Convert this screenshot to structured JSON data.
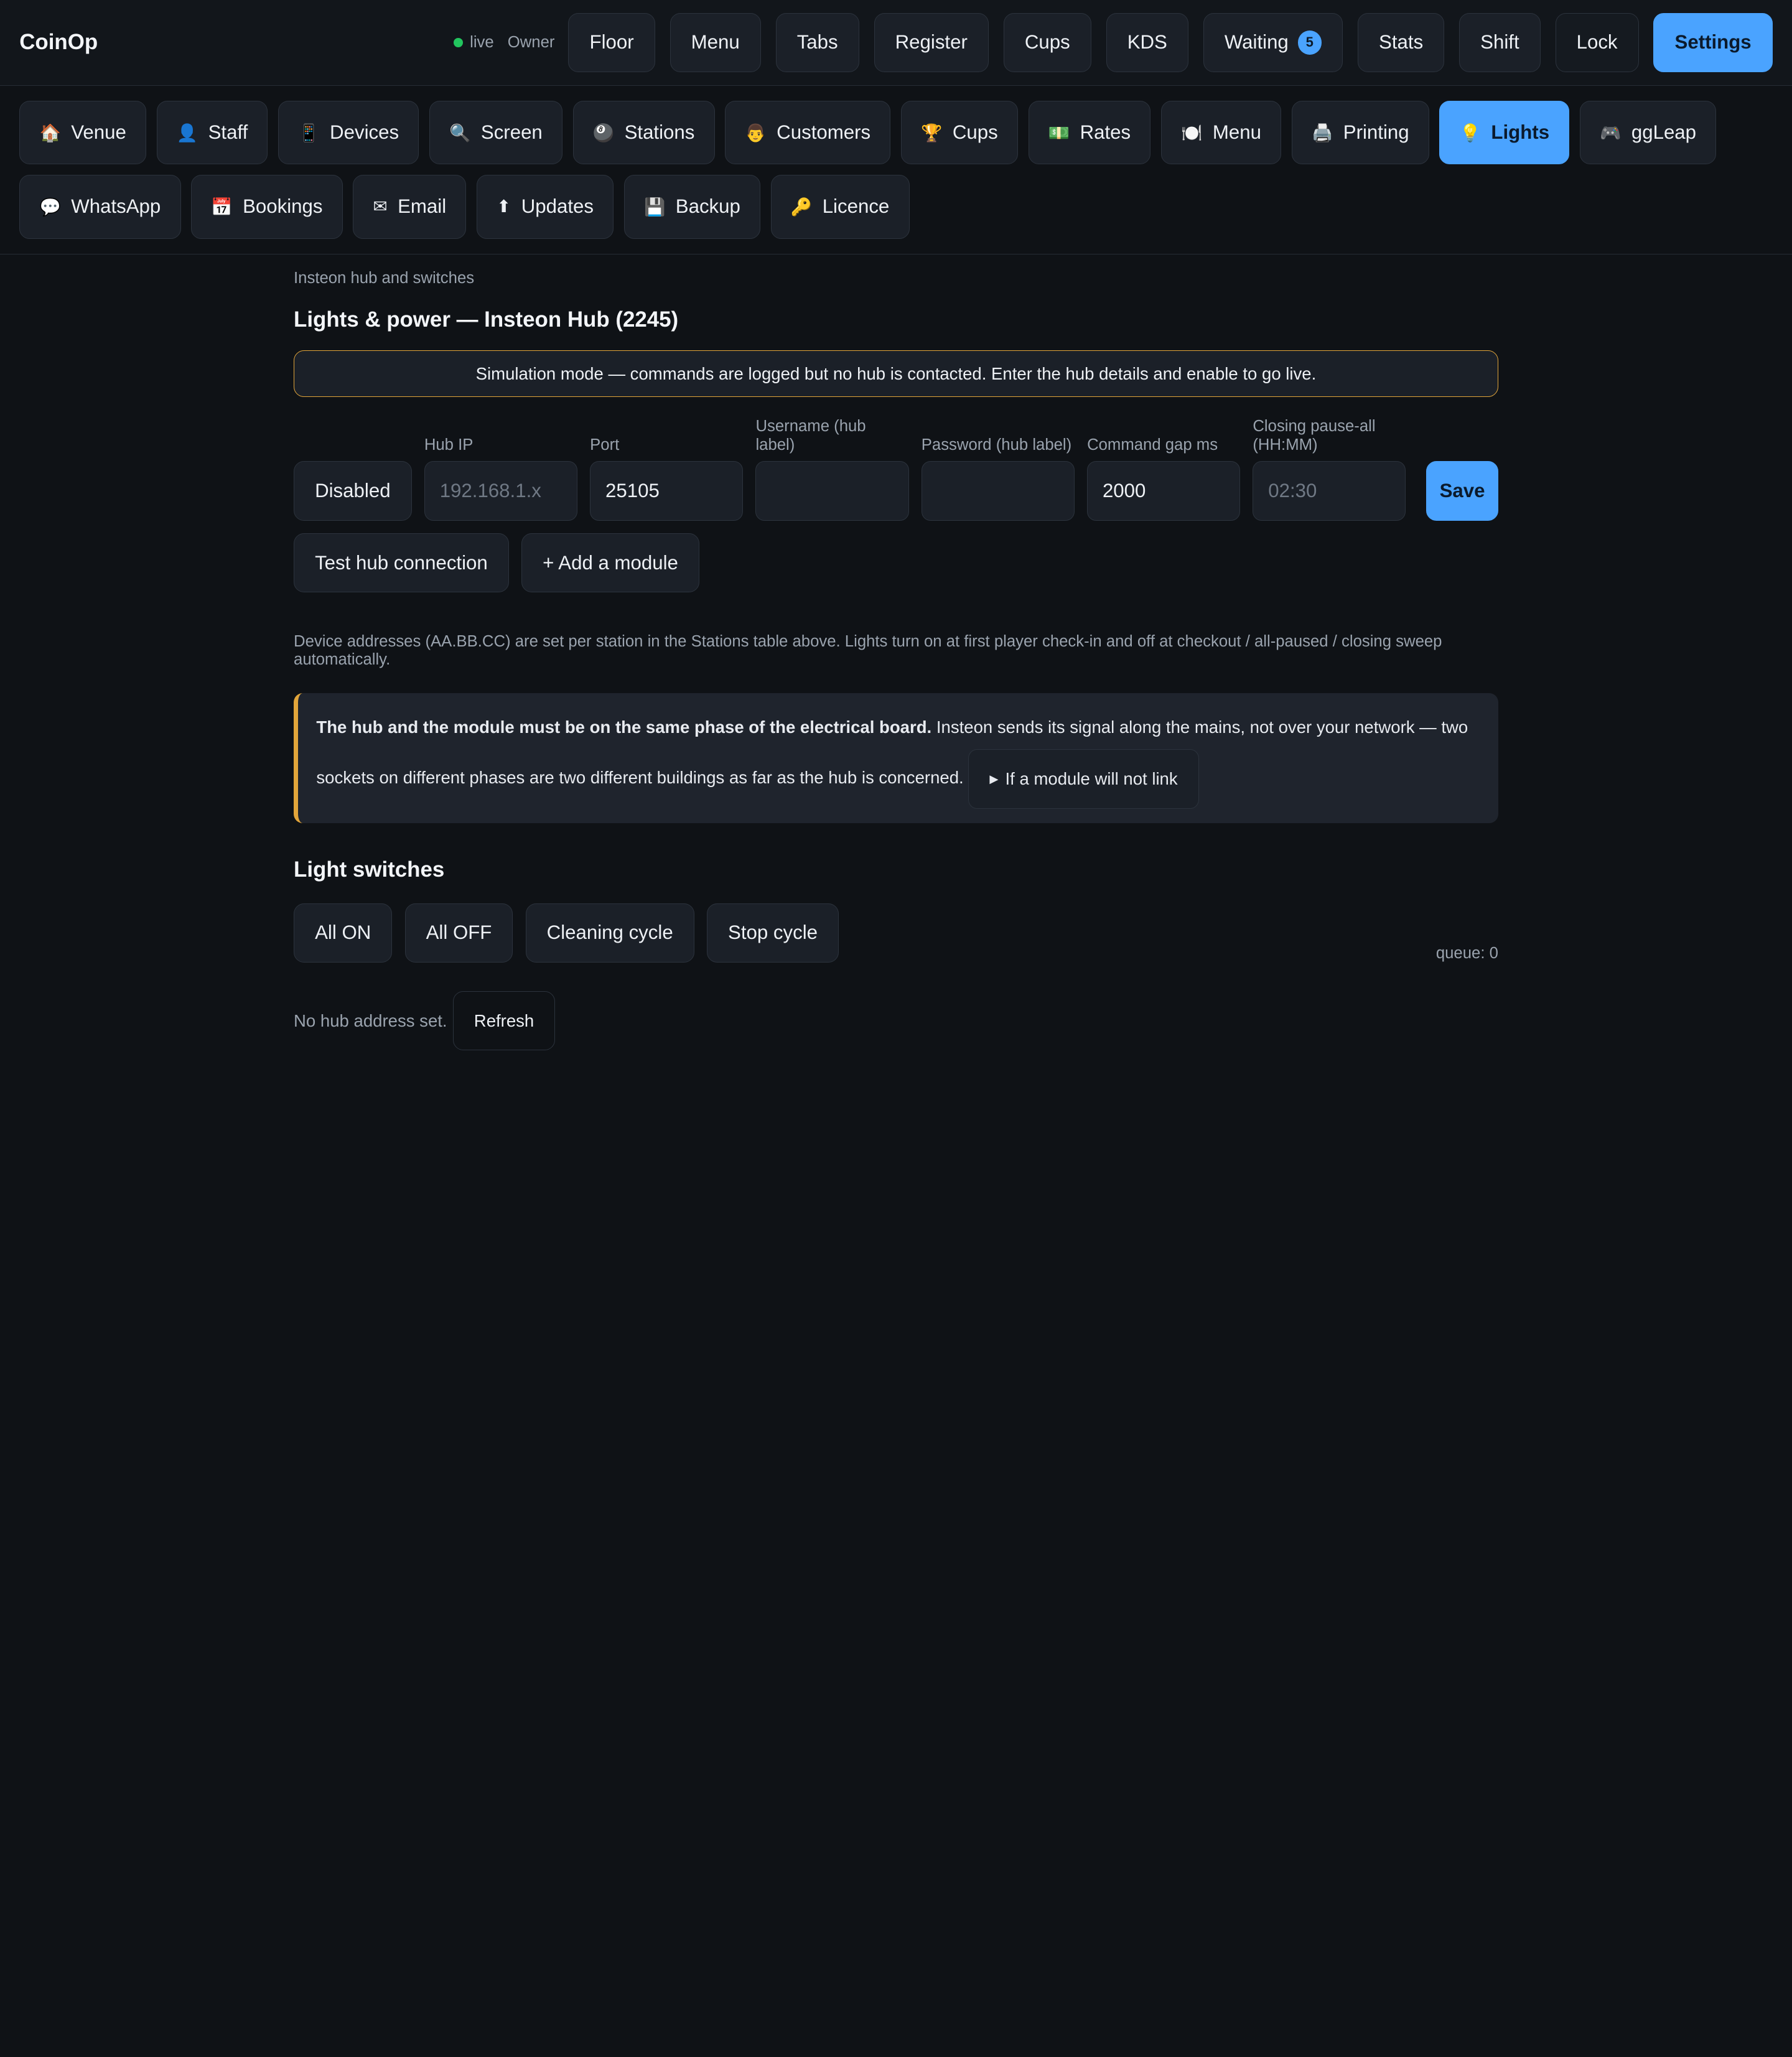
{
  "app": {
    "title": "CoinOp",
    "status": "live",
    "role": "Owner"
  },
  "colors": {
    "accent": "#4aa3ff",
    "warning": "#e2a53a",
    "live": "#22c55e"
  },
  "topnav": [
    {
      "label": "Floor"
    },
    {
      "label": "Menu"
    },
    {
      "label": "Tabs"
    },
    {
      "label": "Register"
    },
    {
      "label": "Cups"
    },
    {
      "label": "KDS"
    },
    {
      "label": "Waiting",
      "badge": "5"
    },
    {
      "label": "Stats"
    },
    {
      "label": "Shift"
    },
    {
      "label": "Lock"
    },
    {
      "label": "Settings",
      "active": true
    }
  ],
  "settings_tabs": [
    {
      "icon": "🏠",
      "icon_name": "house-icon",
      "label": "Venue"
    },
    {
      "icon": "👤",
      "icon_name": "person-icon",
      "label": "Staff"
    },
    {
      "icon": "📱",
      "icon_name": "phone-icon",
      "label": "Devices"
    },
    {
      "icon": "🔍",
      "icon_name": "magnifier-icon",
      "label": "Screen"
    },
    {
      "icon": "🎱",
      "icon_name": "eight-ball-icon",
      "label": "Stations"
    },
    {
      "icon": "👨",
      "icon_name": "face-icon",
      "label": "Customers"
    },
    {
      "icon": "🏆",
      "icon_name": "trophy-icon",
      "label": "Cups"
    },
    {
      "icon": "💵",
      "icon_name": "money-icon",
      "label": "Rates"
    },
    {
      "icon": "🍽️",
      "icon_name": "plate-icon",
      "label": "Menu"
    },
    {
      "icon": "🖨️",
      "icon_name": "printer-icon",
      "label": "Printing"
    },
    {
      "icon": "💡",
      "icon_name": "bulb-icon",
      "label": "Lights",
      "active": true
    },
    {
      "icon": "🎮",
      "icon_name": "gamepad-icon",
      "label": "ggLeap"
    },
    {
      "icon": "💬",
      "icon_name": "speech-bubble-icon",
      "label": "WhatsApp"
    },
    {
      "icon": "📅",
      "icon_name": "calendar-icon",
      "label": "Bookings"
    },
    {
      "icon": "✉",
      "icon_name": "envelope-icon",
      "label": "Email"
    },
    {
      "icon": "⬆",
      "icon_name": "arrow-up-icon",
      "label": "Updates"
    },
    {
      "icon": "💾",
      "icon_name": "floppy-icon",
      "label": "Backup"
    },
    {
      "icon": "🔑",
      "icon_name": "key-icon",
      "label": "Licence"
    }
  ],
  "main": {
    "breadcrumb": "Insteon hub and switches",
    "title": "Lights & power — Insteon Hub (2245)",
    "notice": "Simulation mode — commands are logged but no hub is contacted. Enter the hub details and enable to go live.",
    "enable_toggle": "Disabled",
    "fields": {
      "hub_ip": {
        "label": "Hub IP",
        "value": "",
        "placeholder": "192.168.1.x"
      },
      "port": {
        "label": "Port",
        "value": "25105",
        "placeholder": ""
      },
      "username": {
        "label": "Username (hub label)",
        "value": "",
        "placeholder": ""
      },
      "password": {
        "label": "Password (hub label)",
        "value": "",
        "placeholder": ""
      },
      "command_gap": {
        "label": "Command gap ms",
        "value": "2000",
        "placeholder": ""
      },
      "closing_pause": {
        "label": "Closing pause-all (HH:MM)",
        "value": "",
        "placeholder": "02:30"
      }
    },
    "save_label": "Save",
    "test_label": "Test hub connection",
    "add_module_label": "+ Add a module",
    "help_text": "Device addresses (AA.BB.CC) are set per station in the Stations table above. Lights turn on at first player check-in and off at checkout / all-paused / closing sweep automatically.",
    "warning": {
      "bold": "The hub and the module must be on the same phase of the electrical board.",
      "text": " Insteon sends its signal along the mains, not over your network — two sockets on different phases are two different buildings as far as the hub is concerned.",
      "details_label": "If a module will not link"
    },
    "switches_title": "Light switches",
    "switch_buttons": [
      "All ON",
      "All OFF",
      "Cleaning cycle",
      "Stop cycle"
    ],
    "queue": "queue: 0",
    "hub_status": "No hub address set.",
    "refresh_label": "Refresh"
  }
}
